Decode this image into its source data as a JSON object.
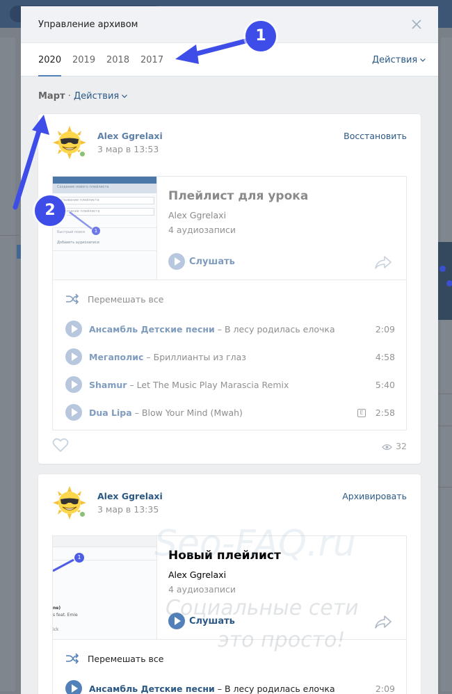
{
  "modal": {
    "title": "Управление архивом"
  },
  "tabs": {
    "years": [
      "2020",
      "2019",
      "2018",
      "2017"
    ],
    "active": "2020",
    "actions_label": "Действия"
  },
  "filter": {
    "month": "Март",
    "separator": "·",
    "actions_label": "Действия"
  },
  "posts": [
    {
      "author": "Alex Ggrelaxi",
      "date": "3 мар в 13:53",
      "action": "Восстановить",
      "playlist": {
        "title": "Плейлист для урока",
        "author": "Alex Ggrelaxi",
        "count": "4 аудиозаписи",
        "listen_label": "Слушать",
        "shuffle_label": "Перемешать все",
        "thumb_lines": [
          "Создание нового плейлиста",
          "Название плейлиста",
          "Описание плейлиста",
          "Быстрый поиск",
          "Добавить аудиозаписи"
        ],
        "tracks": [
          {
            "artist": "Ансамбль Детские песни",
            "sep": "–",
            "title": "В лесу родилась елочка",
            "subtitle": "",
            "duration": "2:09",
            "explicit": ""
          },
          {
            "artist": "Мегаполис",
            "sep": "–",
            "title": "Бриллианты из глаз",
            "subtitle": "",
            "duration": "4:58",
            "explicit": ""
          },
          {
            "artist": "Shamur",
            "sep": "–",
            "title": "Let The Music Play",
            "subtitle": "Marascia Remix",
            "duration": "5:40",
            "explicit": ""
          },
          {
            "artist": "Dua Lipa",
            "sep": "–",
            "title": "Blow Your Mind (Mwah)",
            "subtitle": "",
            "duration": "2:58",
            "explicit": "E"
          }
        ]
      },
      "views": "32"
    },
    {
      "author": "Alex Ggrelaxi",
      "date": "3 мар в 13:35",
      "action": "Архивировать",
      "playlist": {
        "title": "Новый плейлист",
        "author": "Alex Ggrelaxi",
        "count": "4 аудиозаписи",
        "listen_label": "Слушать",
        "shuffle_label": "Перемешать все",
        "thumb_lines": [
          "ne)",
          "s feat. Emie",
          "ick"
        ],
        "tracks": [
          {
            "artist": "Ансамбль Детские песни",
            "sep": "–",
            "title": "В лесу родилась елочка",
            "subtitle": "",
            "duration": "2:09",
            "explicit": ""
          }
        ]
      }
    }
  ],
  "annotations": {
    "marker1": "1",
    "marker2": "2",
    "thumb_marker": "1"
  },
  "watermark": {
    "line1": "Seo-FAQ.ru",
    "line2a": "Социальные сети",
    "line2b": "это просто!"
  },
  "colors": {
    "accent": "#5181b8",
    "link": "#2a5885",
    "marker": "#3f4de8"
  }
}
